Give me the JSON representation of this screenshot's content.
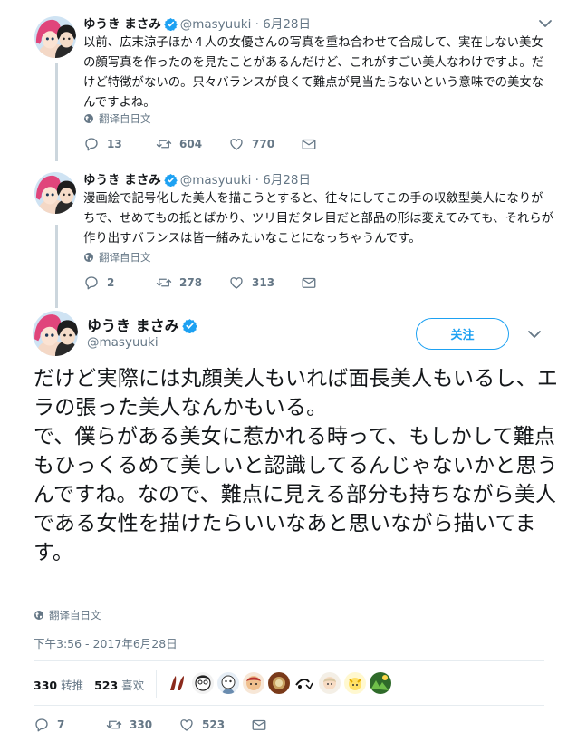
{
  "colors": {
    "accent": "#1da1f2",
    "muted": "#657786",
    "text": "#14171a",
    "border": "#e6ecf0"
  },
  "tweets": [
    {
      "name": "ゆうき まさみ",
      "handle": "@masyuuki",
      "dot": "·",
      "date": "6月28日",
      "text": "以前、広末涼子ほか４人の女優さんの写真を重ね合わせて合成して、実在しない美女の顔写真を作ったのを見たことがあるんだけど、これがすごい美人なわけですよ。だけど特徴がないの。只々バランスが良くて難点が見当たらないという意味での美女なんですよね。",
      "translate": "翻译自日文",
      "replies": "13",
      "retweets": "604",
      "likes": "770"
    },
    {
      "name": "ゆうき まさみ",
      "handle": "@masyuuki",
      "dot": "·",
      "date": "6月28日",
      "text": "漫画絵で記号化した美人を描こうとすると、往々にしてこの手の収斂型美人になりがちで、せめてもの抵とばかり、ツリ目だタレ目だと部品の形は変えてみても、それらが作り出すバランスは皆一緒みたいなことになっちゃうんです。",
      "translate": "翻译自日文",
      "replies": "2",
      "retweets": "278",
      "likes": "313"
    }
  ],
  "main": {
    "name": "ゆうき まさみ",
    "handle": "@masyuuki",
    "follow": "关注",
    "text": "だけど実際には丸顔美人もいれば面長美人もいるし、エラの張った美人なんかもいる。\nで、僕らがある美女に惹かれる時って、もしかして難点もひっくるめて美しいと認識してるんじゃないかと思うんですね。なので、難点に見える部分も持ちながら美人である女性を描けたらいいなあと思いながら描いてます。",
    "translate": "翻译自日文",
    "time": "下午3:56 - 2017年6月28日",
    "retweet_count": "330",
    "retweet_label": "转推",
    "like_count": "523",
    "like_label": "喜欢",
    "replies": "7",
    "retweets": "330",
    "likes": "523"
  },
  "icons": [
    "reply-icon",
    "retweet-icon",
    "like-icon",
    "dm-icon",
    "globe-icon",
    "verified-icon",
    "chevron-down-icon"
  ],
  "likers": [
    "liker-avatar-1",
    "liker-avatar-2",
    "liker-avatar-3",
    "liker-avatar-4",
    "liker-avatar-5",
    "liker-avatar-6",
    "liker-avatar-7",
    "liker-avatar-8",
    "liker-avatar-9"
  ]
}
